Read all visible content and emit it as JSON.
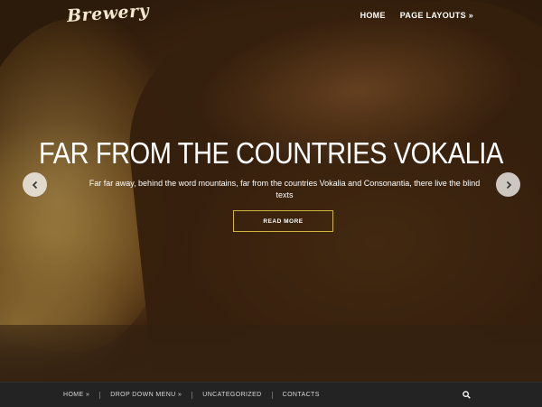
{
  "header": {
    "logo": "Brewery",
    "nav": [
      {
        "label": "HOME"
      },
      {
        "label": "PAGE LAYOUTS »"
      }
    ]
  },
  "slide": {
    "title": "FAR FROM THE COUNTRIES VOKALIA",
    "text": "Far far away, behind the word mountains, far from the countries Vokalia and Consonantia, there live the blind texts",
    "button": "READ MORE",
    "prev_icon": "chevron-left-icon",
    "next_icon": "chevron-right-icon"
  },
  "bottom_nav": {
    "items": [
      {
        "label": "HOME »"
      },
      {
        "label": "DROP DOWN MENU »"
      },
      {
        "label": "UNCATEGORIZED"
      },
      {
        "label": "CONTACTS"
      }
    ],
    "search_icon": "search-icon"
  },
  "colors": {
    "accent": "#d2b33b",
    "bar": "#232323"
  }
}
